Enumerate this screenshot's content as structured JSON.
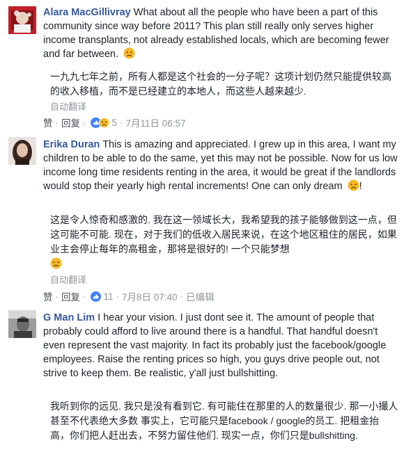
{
  "comments": [
    {
      "author": "Alara MacGillivray",
      "text": "What about all the people who have been a part of this community since way before 2011? This plan still really only serves higher income transplants, not already established locals, which are becoming fewer and far between.",
      "translation": "一九九七年之前，所有人都是这个社会的一分子呢？这项计划仍然只能提供较高的收入移植，而不是已经建立的本地人，而这些人越来越少.",
      "auto_translate": "自动翻译",
      "like_label": "赞",
      "reply_label": "回复",
      "reaction_count": "5",
      "timestamp": "7月11日 06:57",
      "edited": ""
    },
    {
      "author": "Erika Duran",
      "text": "This is amazing and appreciated. I grew up in this area, I want my children to be able to do the same, yet this may not be possible. Now for us low income long time residents renting in the area, it would be great if the landlords would stop their yearly high rental increments! One can only dream",
      "text_suffix": "!",
      "translation": "这是令人惊奇和感激的. 我在这一领域长大，我希望我的孩子能够做到这一点，但这可能不可能. 现在，对于我们的低收入居民来说，在这个地区租住的居民，如果业主会停止每年的高租金，那将是很好的! 一个只能梦想",
      "auto_translate": "自动翻译",
      "like_label": "赞",
      "reply_label": "回复",
      "reaction_count": "11",
      "timestamp": "7月8日 07:40",
      "edited": "已编辑"
    },
    {
      "author": "G Man Lim",
      "text": "I hear your vision. I just dont see it. The amount of people that probably could afford to live around there is a handful. That handful doesn't even represent the vast majority. In fact its probably just the facebook/google employees. Raise the renting prices so high, you guys drive people out, not strive to keep them. Be realistic, y'all just bullshitting.",
      "translation": "我听到你的远见. 我只是没有看到它. 有可能住在那里的人的数量很少. 那一小撮人甚至不代表绝大多数 事实上，它可能只是facebook / google的员工. 把租金抬高，你们把人赶出去，不努力留住他们. 现实一点，你们只是bullshitting."
    }
  ],
  "separator": "·",
  "icons": {
    "reactions_1": [
      "like-icon",
      "sad-face-icon"
    ],
    "reactions_2": [
      "like-icon"
    ],
    "emoji": "sad-face-icon"
  },
  "colors": {
    "author": "#365899",
    "like_blue": "#4080ff",
    "sad_yellow": "#f7b928",
    "meta_gray": "#90949c"
  }
}
